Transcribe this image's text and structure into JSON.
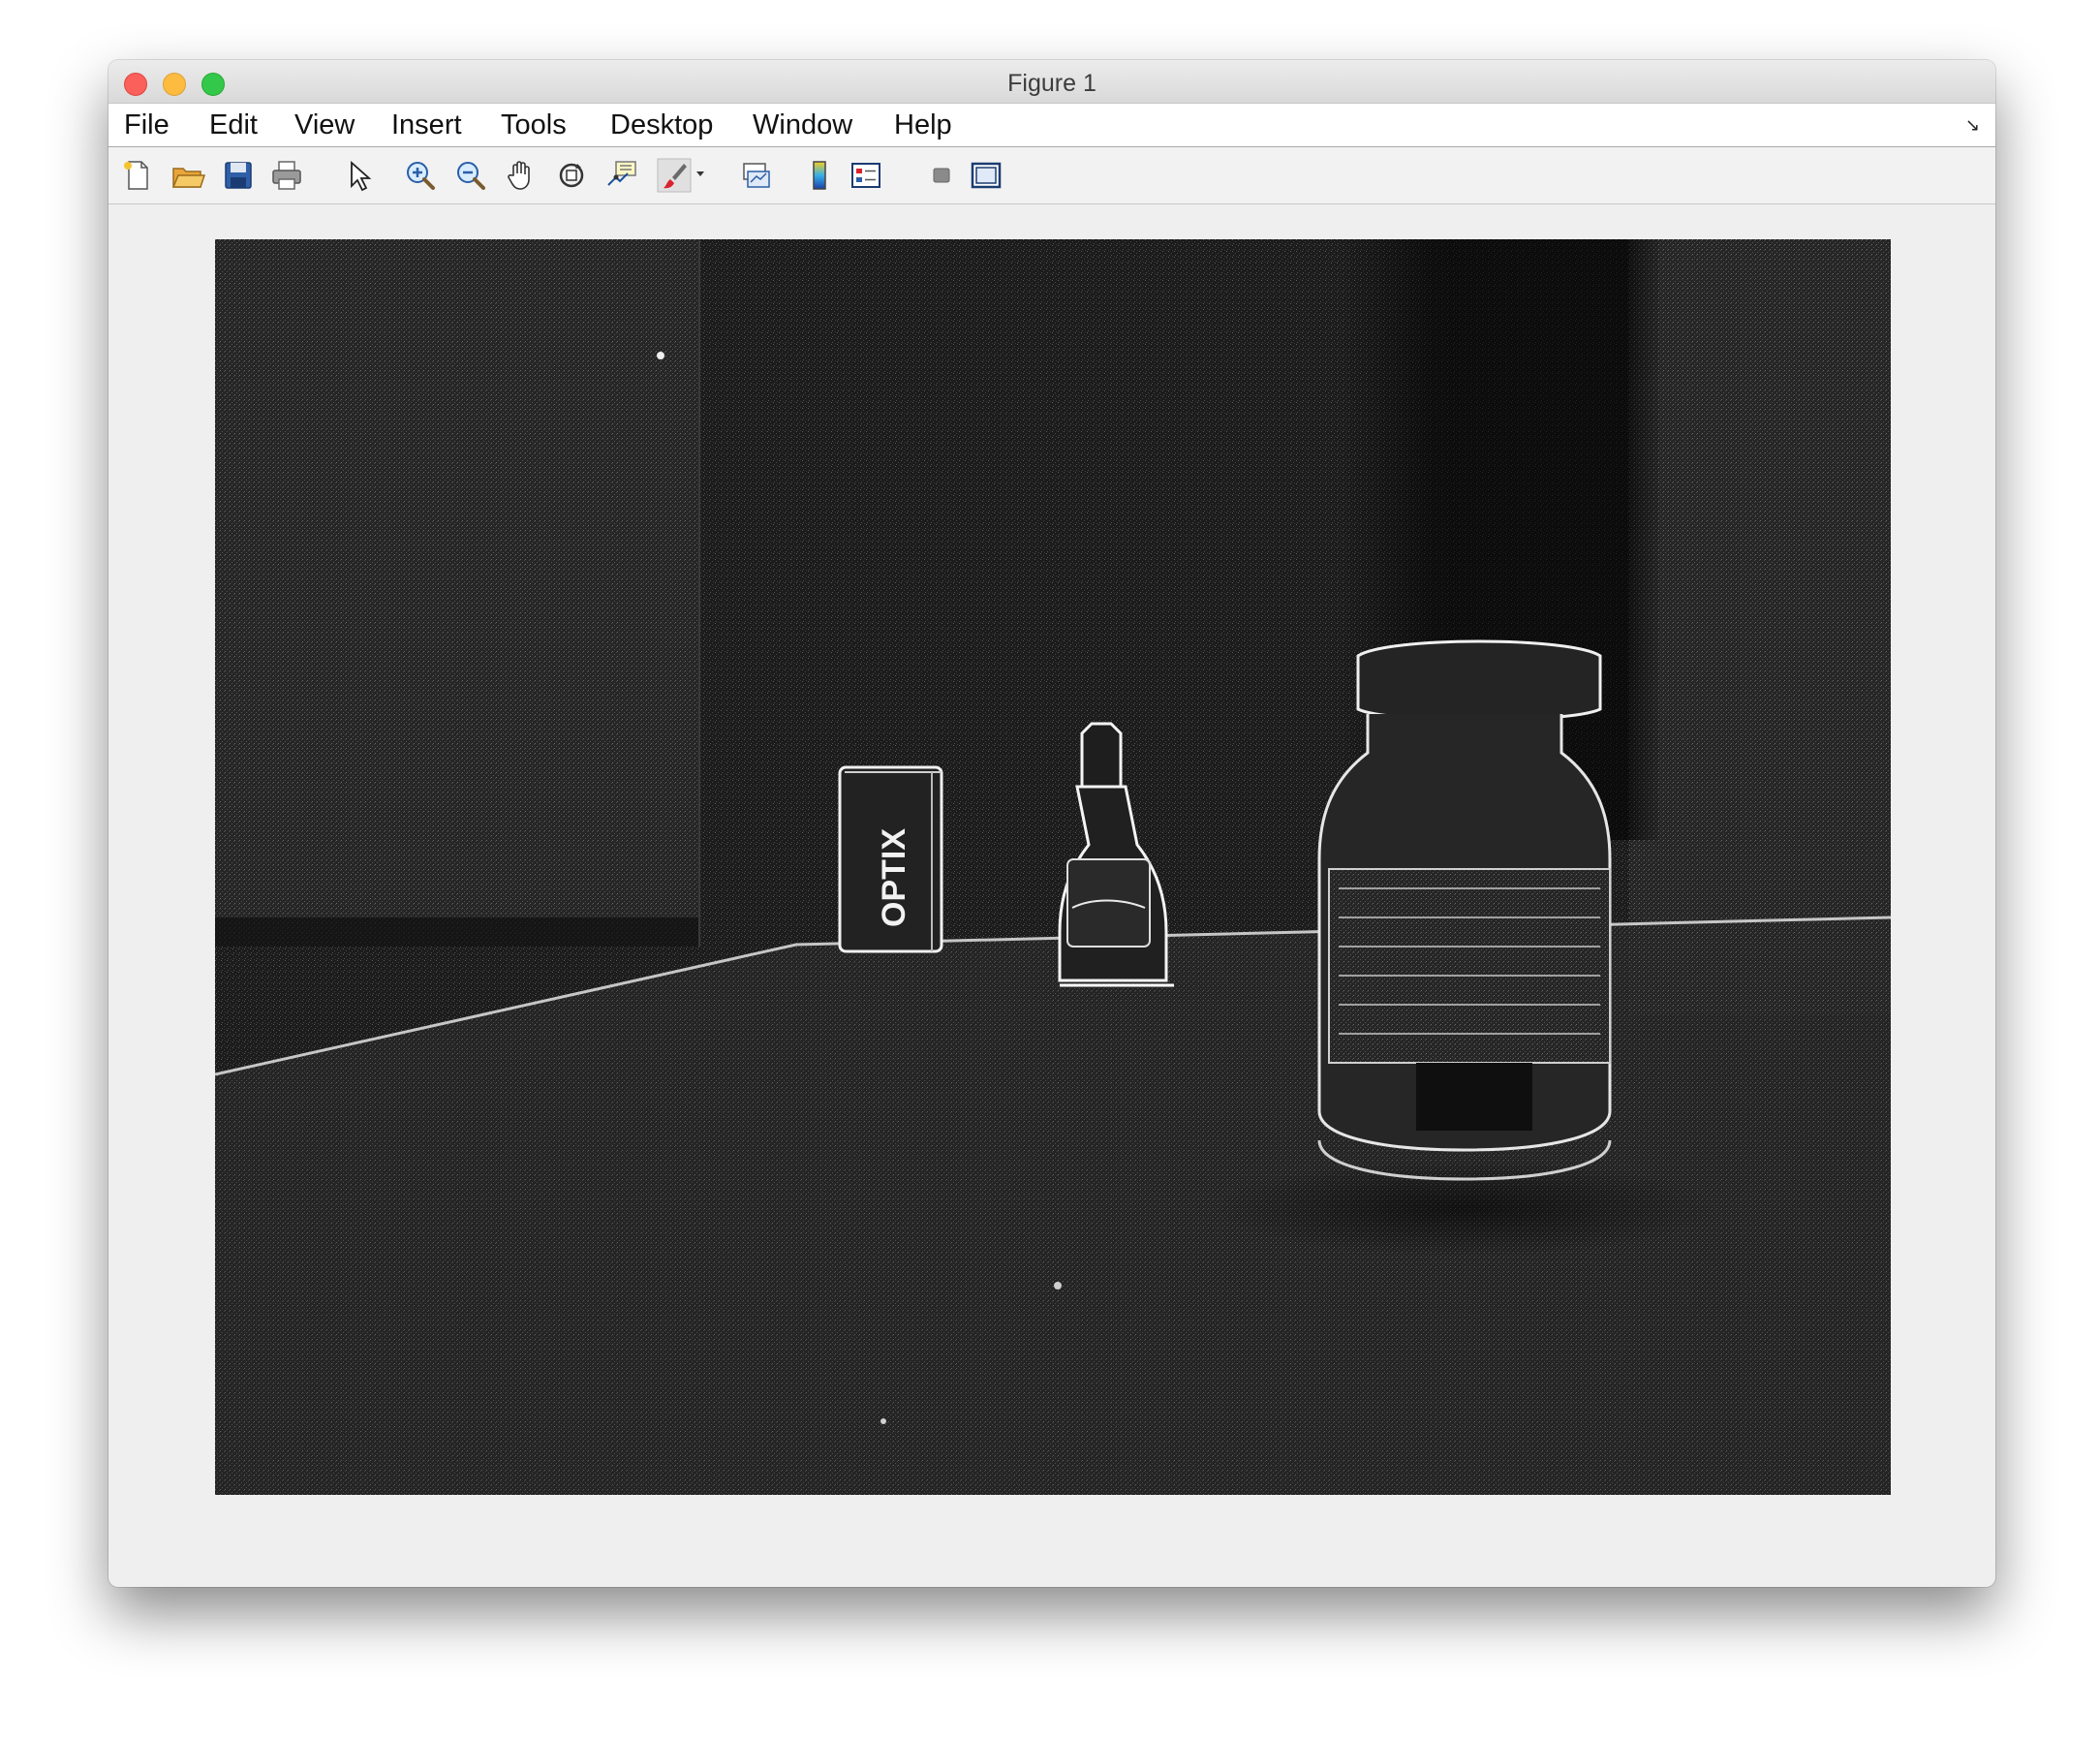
{
  "window": {
    "title": "Figure 1"
  },
  "menubar": {
    "items": [
      "File",
      "Edit",
      "View",
      "Insert",
      "Tools",
      "Desktop",
      "Window",
      "Help"
    ]
  },
  "toolbar": {
    "buttons": [
      {
        "name": "new-figure-icon"
      },
      {
        "name": "open-file-icon"
      },
      {
        "name": "save-figure-icon"
      },
      {
        "name": "print-figure-icon"
      },
      {
        "name": "edit-plot-pointer-icon"
      },
      {
        "name": "zoom-in-icon"
      },
      {
        "name": "zoom-out-icon"
      },
      {
        "name": "pan-hand-icon"
      },
      {
        "name": "rotate-3d-icon"
      },
      {
        "name": "data-cursor-icon"
      },
      {
        "name": "brush-icon"
      },
      {
        "name": "link-plot-icon"
      },
      {
        "name": "insert-colorbar-icon"
      },
      {
        "name": "insert-legend-icon"
      },
      {
        "name": "hide-plot-tools-icon"
      },
      {
        "name": "show-plot-tools-icon"
      }
    ]
  },
  "image": {
    "label_text": "OPTIX",
    "description_icon": "edge-filtered-photo"
  },
  "colors": {
    "close": "#fc605b",
    "minimize": "#fdbc40",
    "maximize": "#34c84a",
    "figure_bg": "#efefef"
  }
}
